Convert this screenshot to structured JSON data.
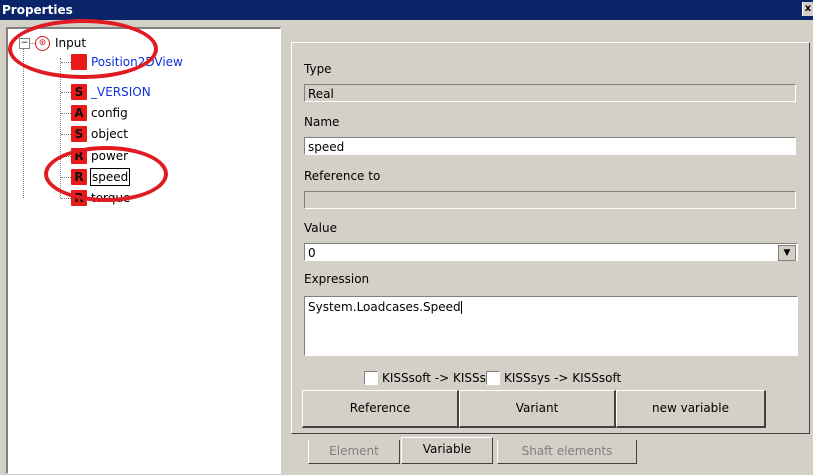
{
  "window": {
    "title": "Properties",
    "close_label": "x"
  },
  "tree": {
    "root_label": "Input",
    "items": [
      {
        "badge": "",
        "label": "Position2DView",
        "color": "blue"
      },
      {
        "badge": "S",
        "label": "_VERSION",
        "color": "blue"
      },
      {
        "badge": "A",
        "label": "config",
        "color": "black"
      },
      {
        "badge": "S",
        "label": "object",
        "color": "black"
      },
      {
        "badge": "R",
        "label": "power",
        "color": "black"
      },
      {
        "badge": "R",
        "label": "speed",
        "color": "black",
        "selected": true
      },
      {
        "badge": "R",
        "label": "torque",
        "color": "black"
      }
    ]
  },
  "properties": {
    "type_label": "Type",
    "type_value": "Real",
    "name_label": "Name",
    "name_value": "speed",
    "reference_label": "Reference to",
    "reference_value": "",
    "value_label": "Value",
    "value_value": "0",
    "expression_label": "Expression",
    "expression_value": "System.Loadcases.Speed",
    "checkbox_1_label": "KISSsoft -> KISSsys",
    "checkbox_2_label": "KISSsys -> KISSsoft",
    "buttons": {
      "reference": "Reference",
      "variant": "Variant",
      "new_variable": "new variable"
    }
  },
  "tabs": {
    "element": "Element",
    "variable": "Variable",
    "shaft_elements": "Shaft elements"
  },
  "colors": {
    "titlebar": "#0a246a",
    "badge": "#e81a1a",
    "annotation": "#e11b22",
    "link_blue": "#1030e0"
  }
}
